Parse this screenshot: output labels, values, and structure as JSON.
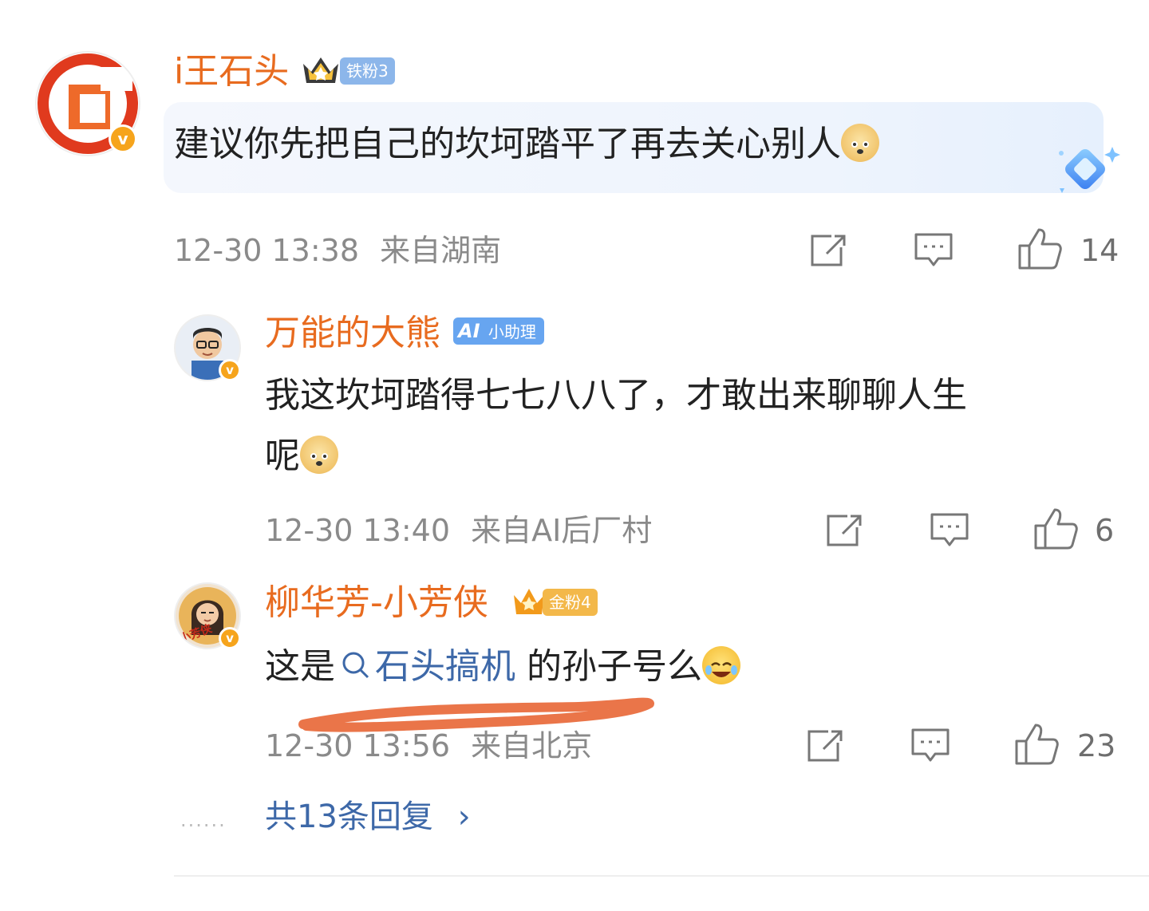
{
  "comment": {
    "username": "i王石头",
    "fan_badge": "铁粉3",
    "text": "建议你先把自己的坎坷踏平了再去关心别人",
    "timestamp": "12-30 13:38",
    "location": "来自湖南",
    "likes": "14",
    "verified_badge": "v",
    "emoji_icon": "doge-emoji-icon"
  },
  "replies": [
    {
      "username": "万能的大熊",
      "badge": "小助理",
      "badge_prefix": "AI",
      "text_line1": "我这坎坷踏得七七八八了，才敢出来聊聊人生",
      "text_line2": "呢",
      "timestamp": "12-30 13:40",
      "location": "来自AI后厂村",
      "likes": "6",
      "verified_badge": "v"
    },
    {
      "username": "柳华芳-小芳侠",
      "fan_badge": "金粉4",
      "text_before": "这是",
      "search_link": "石头搞机",
      "text_after": " 的孙子号么",
      "timestamp": "12-30 13:56",
      "location": "来自北京",
      "likes": "23",
      "verified_badge": "v",
      "avatar_text": "小芳侠"
    }
  ],
  "more_replies": {
    "dots": "......",
    "label": "共13条回复",
    "chevron": "›"
  },
  "colors": {
    "username": "#e86b1f",
    "link": "#3d68a8",
    "meta": "#8a8a8a",
    "annotation_stroke": "#e8693a"
  }
}
